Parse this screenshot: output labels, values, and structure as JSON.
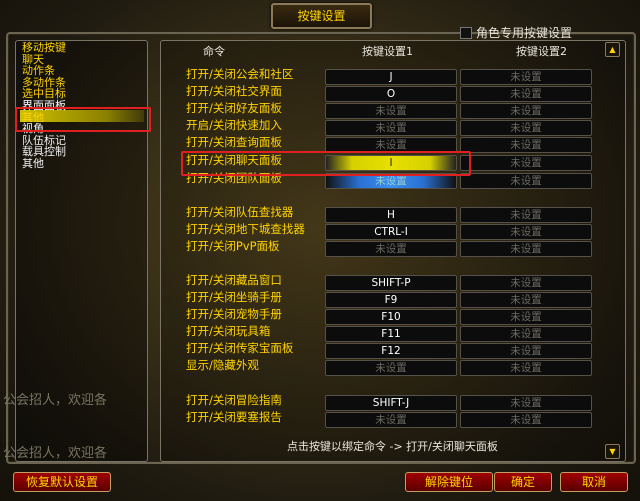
{
  "window": {
    "title": "按键设置"
  },
  "char_specific": {
    "label": "角色专用按键设置",
    "checked": false
  },
  "categories": [
    {
      "label": "移动按键",
      "selected": false
    },
    {
      "label": "聊天",
      "selected": false
    },
    {
      "label": "动作条",
      "selected": false
    },
    {
      "label": "多动作条",
      "selected": false
    },
    {
      "label": "选中目标",
      "selected": false
    },
    {
      "label": "界面面板",
      "selected": true
    },
    {
      "label": "其他",
      "selected": false
    },
    {
      "label": "视角",
      "selected": false
    },
    {
      "label": "队伍标记",
      "selected": false
    },
    {
      "label": "载具控制",
      "selected": false
    },
    {
      "label": "其他",
      "selected": false
    }
  ],
  "chat_lines": [
    "公会招人，欢迎各",
    "公会招人，欢迎各"
  ],
  "columns": {
    "command": "命令",
    "binding1": "按键设置1",
    "binding2": "按键设置2"
  },
  "unset_label": "未设置",
  "bindings": [
    {
      "command": "打开/关闭公会和社区",
      "key1": "J",
      "key2": "未设置"
    },
    {
      "command": "打开/关闭社交界面",
      "key1": "O",
      "key2": "未设置"
    },
    {
      "command": "打开/关闭好友面板",
      "key1": "未设置",
      "key2": "未设置"
    },
    {
      "command": "开启/关闭快速加入",
      "key1": "未设置",
      "key2": "未设置"
    },
    {
      "command": "打开/关闭查询面板",
      "key1": "未设置",
      "key2": "未设置"
    },
    {
      "command": "打开/关闭聊天面板",
      "key1": "I",
      "key2": "未设置"
    },
    {
      "command": "打开/关闭团队面板",
      "key1": "未设置",
      "key2": "未设置"
    },
    {
      "command": "打开/关闭队伍查找器",
      "key1": "H",
      "key2": "未设置"
    },
    {
      "command": "打开/关闭地下城查找器",
      "key1": "CTRL-I",
      "key2": "未设置"
    },
    {
      "command": "打开/关闭PvP面板",
      "key1": "未设置",
      "key2": "未设置"
    },
    {
      "command": "打开/关闭藏品窗口",
      "key1": "SHIFT-P",
      "key2": "未设置"
    },
    {
      "command": "打开/关闭坐骑手册",
      "key1": "F9",
      "key2": "未设置"
    },
    {
      "command": "打开/关闭宠物手册",
      "key1": "F10",
      "key2": "未设置"
    },
    {
      "command": "打开/关闭玩具箱",
      "key1": "F11",
      "key2": "未设置"
    },
    {
      "command": "打开/关闭传家宝面板",
      "key1": "F12",
      "key2": "未设置"
    },
    {
      "command": "显示/隐藏外观",
      "key1": "未设置",
      "key2": "未设置"
    },
    {
      "command": "打开/关闭冒险指南",
      "key1": "SHIFT-J",
      "key2": "未设置"
    },
    {
      "command": "打开/关闭要塞报告",
      "key1": "未设置",
      "key2": "未设置"
    }
  ],
  "hint": "点击按键以绑定命令 -> 打开/关闭聊天面板",
  "buttons": {
    "reset": "恢复默认设置",
    "unbind": "解除键位",
    "ok": "确定",
    "cancel": "取消"
  }
}
